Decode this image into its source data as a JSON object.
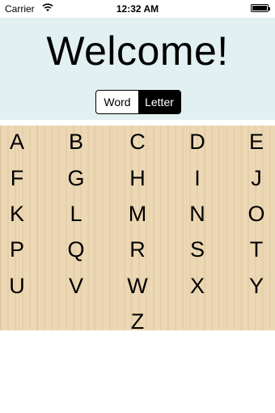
{
  "status_bar": {
    "carrier": "Carrier",
    "time": "12:32 AM",
    "wifi_icon": "wifi-icon",
    "battery_icon": "battery-icon"
  },
  "header": {
    "title": "Welcome!",
    "segmented_control": {
      "options": [
        "Word",
        "Letter"
      ],
      "selected": "Letter"
    },
    "background_color": "#e2f0f1"
  },
  "keyboard": {
    "background_color": "#ecd6b1",
    "letters": [
      "A",
      "B",
      "C",
      "D",
      "E",
      "F",
      "G",
      "H",
      "I",
      "J",
      "K",
      "L",
      "M",
      "N",
      "O",
      "P",
      "Q",
      "R",
      "S",
      "T",
      "U",
      "V",
      "W",
      "X",
      "Y",
      "Z"
    ]
  }
}
